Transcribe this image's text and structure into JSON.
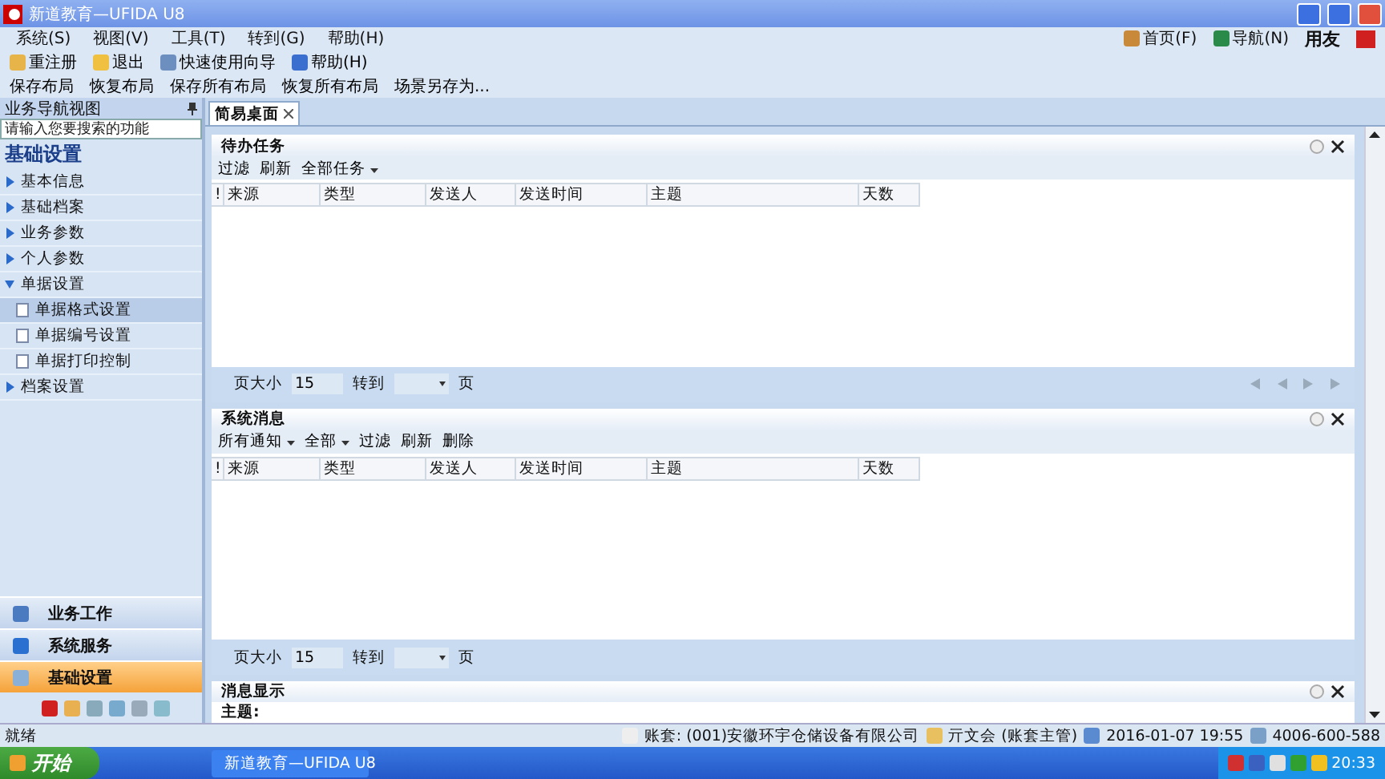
{
  "window": {
    "title": "新道教育—UFIDA U8"
  },
  "menu": [
    "系统(S)",
    "视图(V)",
    "工具(T)",
    "转到(G)",
    "帮助(H)"
  ],
  "toolbar": [
    {
      "label": "重注册"
    },
    {
      "label": "退出"
    },
    {
      "label": "快速使用向导"
    },
    {
      "label": "帮助(H)"
    }
  ],
  "layout_toolbar": [
    "保存布局",
    "恢复布局",
    "保存所有布局",
    "恢复所有布局",
    "场景另存为..."
  ],
  "header_links": [
    {
      "label": "首页(F)"
    },
    {
      "label": "导航(N)"
    }
  ],
  "brand": "用友",
  "nav": {
    "title": "业务导航视图",
    "search_placeholder": "请输入您要搜索的功能",
    "section": "基础设置",
    "items": [
      {
        "label": "基本信息",
        "expanded": false
      },
      {
        "label": "基础档案",
        "expanded": false
      },
      {
        "label": "业务参数",
        "expanded": false
      },
      {
        "label": "个人参数",
        "expanded": false
      },
      {
        "label": "单据设置",
        "expanded": true,
        "children": [
          {
            "label": "单据格式设置",
            "selected": true
          },
          {
            "label": "单据编号设置",
            "selected": false
          },
          {
            "label": "单据打印控制",
            "selected": false
          }
        ]
      },
      {
        "label": "档案设置",
        "expanded": false
      }
    ]
  },
  "nav_buttons": [
    {
      "label": "业务工作",
      "selected": false
    },
    {
      "label": "系统服务",
      "selected": false
    },
    {
      "label": "基础设置",
      "selected": true
    }
  ],
  "tabs": [
    {
      "label": "简易桌面",
      "selected": true
    }
  ],
  "panels": [
    {
      "kind": "grid",
      "title": "待办任务",
      "actions": [
        {
          "label": "过滤",
          "dropdown": false
        },
        {
          "label": "刷新",
          "dropdown": false
        },
        {
          "label": "全部任务",
          "dropdown": true
        }
      ],
      "columns": [
        "!",
        "来源",
        "类型",
        "发送人",
        "发送时间",
        "主题",
        "天数"
      ],
      "pager": {
        "size_label": "页大小",
        "size": "15",
        "goto_label": "转到",
        "page_label": "页"
      }
    },
    {
      "kind": "grid",
      "title": "系统消息",
      "actions": [
        {
          "label": "所有通知",
          "dropdown": true
        },
        {
          "label": "全部",
          "dropdown": true
        },
        {
          "label": "过滤",
          "dropdown": false
        },
        {
          "label": "刷新",
          "dropdown": false
        },
        {
          "label": "删除",
          "dropdown": false
        }
      ],
      "columns": [
        "!",
        "来源",
        "类型",
        "发送人",
        "发送时间",
        "主题",
        "天数"
      ],
      "pager": {
        "size_label": "页大小",
        "size": "15",
        "goto_label": "转到",
        "page_label": "页"
      }
    },
    {
      "kind": "message",
      "title": "消息显示",
      "field_label": "主题:"
    }
  ],
  "status_bar": {
    "text": "就绪",
    "account": "账套: (001)安徽环宇仓储设备有限公司",
    "user": "亓文会 (账套主管)",
    "datetime": "2016-01-07  19:55",
    "phone": "4006-600-588"
  },
  "taskbar": {
    "start": "开始",
    "window": "新道教育—UFIDA U8",
    "clock": "20:33"
  }
}
